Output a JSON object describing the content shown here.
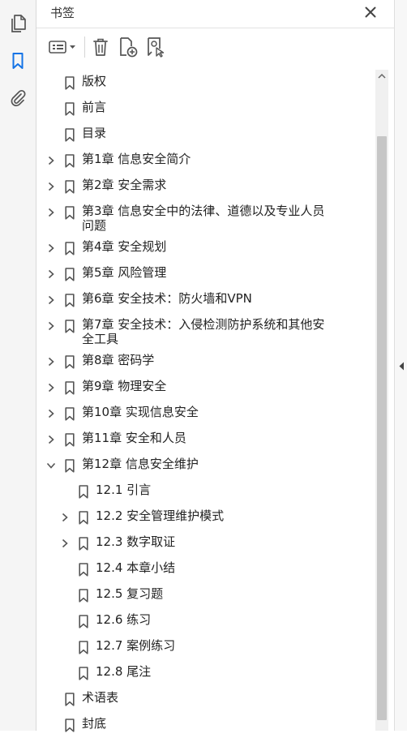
{
  "panel": {
    "title": "书签",
    "close_icon": "close-icon"
  },
  "rail": {
    "items": [
      {
        "icon": "page-thumbnails-icon",
        "active": false
      },
      {
        "icon": "bookmark-icon",
        "active": true
      },
      {
        "icon": "attachment-icon",
        "active": false
      }
    ]
  },
  "toolbar": {
    "items": [
      {
        "icon": "options-menu-icon"
      },
      {
        "icon": "delete-icon"
      },
      {
        "icon": "new-bookmark-icon"
      },
      {
        "icon": "bookmark-from-selection-icon"
      }
    ]
  },
  "colors": {
    "accent": "#1473e6",
    "icon": "#555555",
    "text": "#222222"
  },
  "bookmarks": [
    {
      "label": "版权",
      "level": 0,
      "expander": "none"
    },
    {
      "label": "前言",
      "level": 0,
      "expander": "none"
    },
    {
      "label": "目录",
      "level": 0,
      "expander": "none"
    },
    {
      "label": "第1章  信息安全简介",
      "level": 0,
      "expander": "collapsed"
    },
    {
      "label": "第2章  安全需求",
      "level": 0,
      "expander": "collapsed"
    },
    {
      "label": "第3章  信息安全中的法律、道德以及专业人员问题",
      "level": 0,
      "expander": "collapsed"
    },
    {
      "label": "第4章  安全规划",
      "level": 0,
      "expander": "collapsed"
    },
    {
      "label": "第5章  风险管理",
      "level": 0,
      "expander": "collapsed"
    },
    {
      "label": "第6章  安全技术：防火墙和VPN",
      "level": 0,
      "expander": "collapsed"
    },
    {
      "label": "第7章  安全技术：入侵检测防护系统和其他安全工具",
      "level": 0,
      "expander": "collapsed"
    },
    {
      "label": "第8章  密码学",
      "level": 0,
      "expander": "collapsed"
    },
    {
      "label": "第9章  物理安全",
      "level": 0,
      "expander": "collapsed"
    },
    {
      "label": "第10章  实现信息安全",
      "level": 0,
      "expander": "collapsed"
    },
    {
      "label": "第11章  安全和人员",
      "level": 0,
      "expander": "collapsed"
    },
    {
      "label": "第12章  信息安全维护",
      "level": 0,
      "expander": "expanded"
    },
    {
      "label": "12.1  引言",
      "level": 1,
      "expander": "none"
    },
    {
      "label": "12.2  安全管理维护模式",
      "level": 1,
      "expander": "collapsed"
    },
    {
      "label": "12.3  数字取证",
      "level": 1,
      "expander": "collapsed"
    },
    {
      "label": "12.4  本章小结",
      "level": 1,
      "expander": "none"
    },
    {
      "label": "12.5  复习题",
      "level": 1,
      "expander": "none"
    },
    {
      "label": "12.6  练习",
      "level": 1,
      "expander": "none"
    },
    {
      "label": "12.7  案例练习",
      "level": 1,
      "expander": "none"
    },
    {
      "label": "12.8  尾注",
      "level": 1,
      "expander": "none"
    },
    {
      "label": "术语表",
      "level": 0,
      "expander": "none"
    },
    {
      "label": "封底",
      "level": 0,
      "expander": "none"
    }
  ]
}
